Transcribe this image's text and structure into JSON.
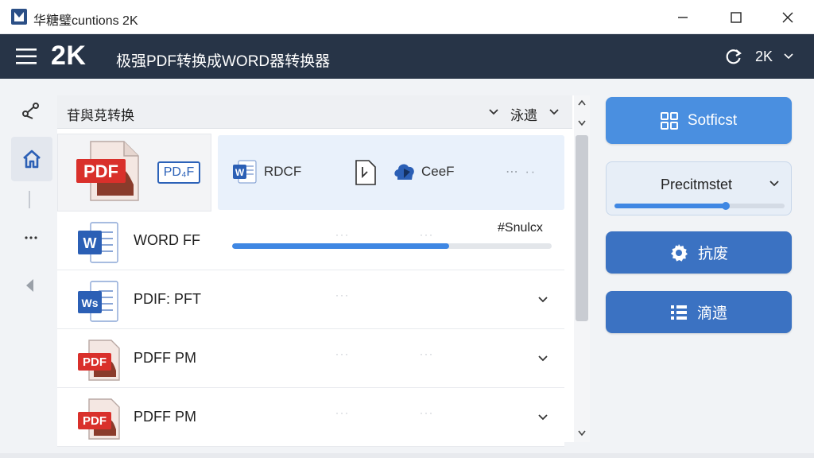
{
  "window": {
    "title": "华糖璧cuntions 2K"
  },
  "header": {
    "brand": "2K",
    "title": "极强PDF转换成WORD器转换器",
    "account_label": "2K"
  },
  "toolbar": {
    "title": "苷與莌转换",
    "filter_label": "泳遗"
  },
  "featured": {
    "pdf_icon_text": "PDF",
    "pdf_tag": "PD₄F",
    "word_label": "RDCF",
    "cloud_label": "CeeF",
    "more": "⋯ ··"
  },
  "files": [
    {
      "name": "WORD FF",
      "icon": "word-icon",
      "status": "#Snulcx",
      "progress": 0.68
    },
    {
      "name": "PDIF: PFT",
      "icon": "word-icon",
      "icon_text": "Ws"
    },
    {
      "name": "PDFF PM",
      "icon": "pdf-icon",
      "icon_text": "PDF"
    },
    {
      "name": "PDFF PM",
      "icon": "pdf-icon",
      "icon_text": "PDF"
    }
  ],
  "word_icon_text": "W",
  "row_dots": "···",
  "right_panel": {
    "primary_button": "Sotficst",
    "preset_label": "Precitmstet",
    "preset_level": 0.66,
    "settings_button": "抗废",
    "list_button": "滴遗"
  },
  "colors": {
    "header_bg": "#273447",
    "accent": "#4a8fe0",
    "pdf_red": "#d9302b",
    "word_blue": "#2b5fb5"
  }
}
